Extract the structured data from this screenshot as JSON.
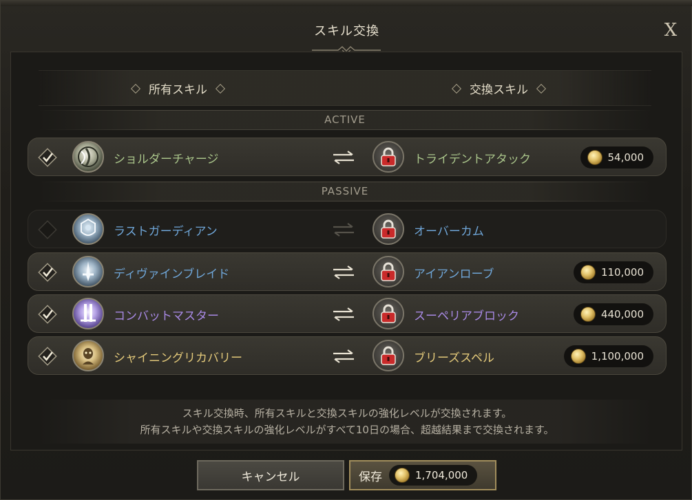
{
  "window": {
    "title": "スキル交換"
  },
  "header": {
    "own_col": "所有スキル",
    "swap_col": "交換スキル"
  },
  "sections": {
    "active": "ACTIVE",
    "passive": "PASSIVE"
  },
  "rows": [
    {
      "checked": true,
      "own_name": "ショルダーチャージ",
      "own_color": "#a9c48a",
      "swap_name": "トライデントアタック",
      "swap_color": "#a9c48a",
      "cost": "54,000",
      "enabled": true
    },
    {
      "checked": false,
      "own_name": "ラストガーディアン",
      "own_color": "#6fa6d8",
      "swap_name": "オーバーカム",
      "swap_color": "#6fa6d8",
      "cost": "",
      "enabled": false
    },
    {
      "checked": true,
      "own_name": "ディヴァインブレイド",
      "own_color": "#6fa6d8",
      "swap_name": "アイアンローブ",
      "swap_color": "#6fa6d8",
      "cost": "110,000",
      "enabled": true
    },
    {
      "checked": true,
      "own_name": "コンバットマスター",
      "own_color": "#a98ae6",
      "swap_name": "スーペリアブロック",
      "swap_color": "#a98ae6",
      "cost": "440,000",
      "enabled": true
    },
    {
      "checked": true,
      "own_name": "シャイニングリカバリー",
      "own_color": "#e3c97a",
      "swap_name": "ブリーズスペル",
      "swap_color": "#e3c97a",
      "cost": "1,100,000",
      "enabled": true
    }
  ],
  "notice": {
    "line1": "スキル交換時、所有スキルと交換スキルの強化レベルが交換されます。",
    "line2": "所有スキルや交換スキルの強化レベルがすべて10日の場合、超越結果まで交換されます。"
  },
  "footer": {
    "cancel_label": "キャンセル",
    "save_label": "保存",
    "total_cost": "1,704,000"
  },
  "icons": {
    "close": "close-icon",
    "check": "checkmark-icon",
    "exchange": "exchange-arrows-icon",
    "lock": "lock-icon",
    "coin": "gold-coin-icon"
  }
}
